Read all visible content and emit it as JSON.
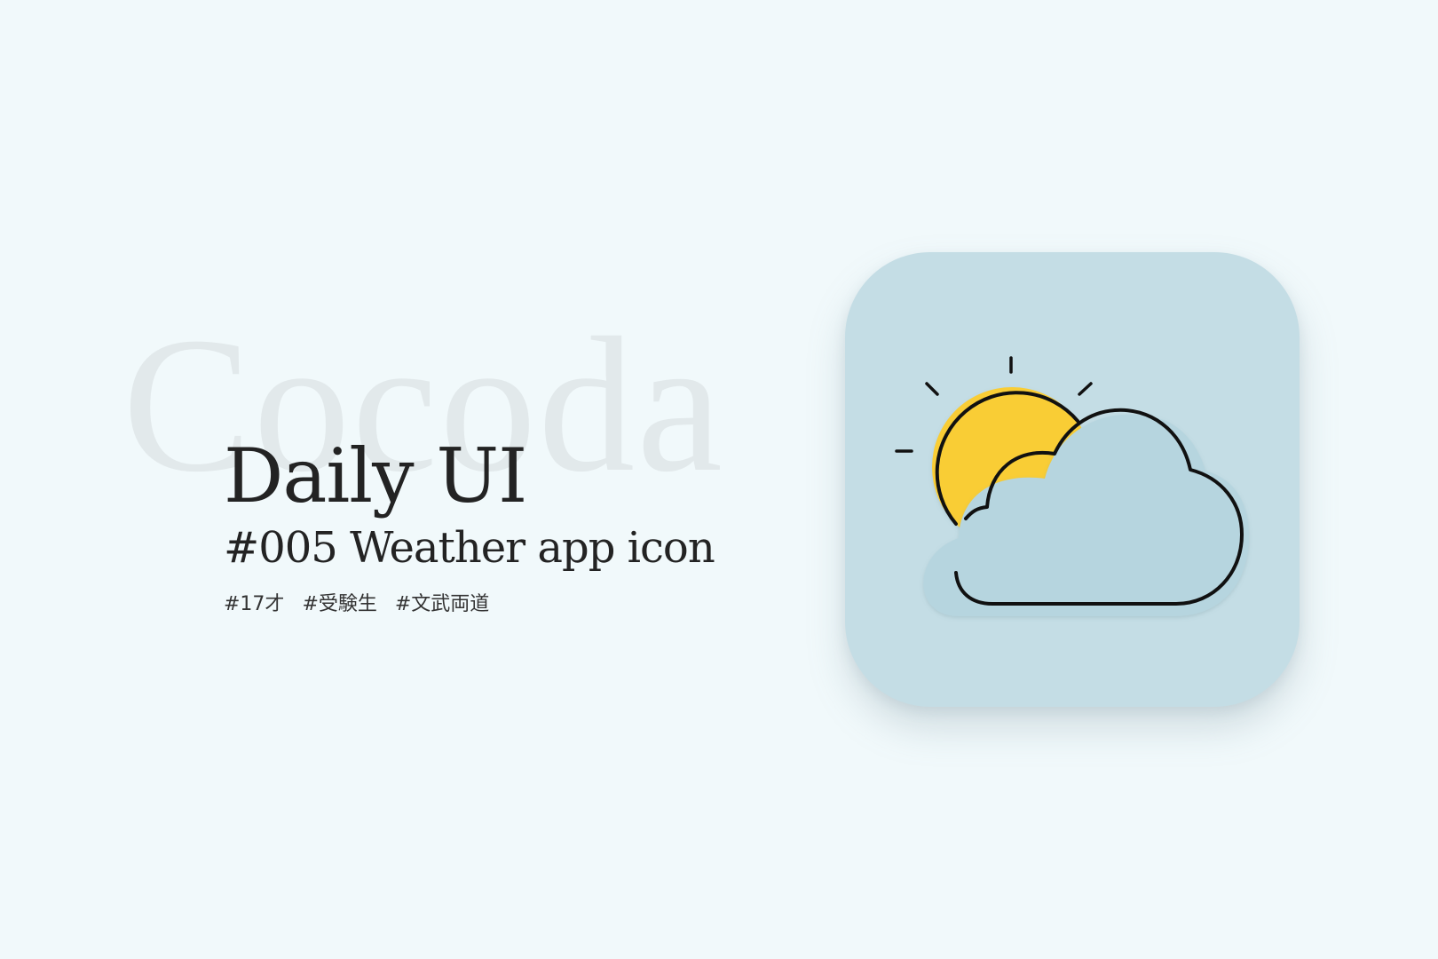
{
  "watermark": "Cocoda",
  "title": "Daily UI",
  "subtitle": "#005 Weather app icon",
  "tags": [
    "#17才",
    "#受験生",
    "#文武両道"
  ],
  "icon": {
    "name": "weather-partly-cloudy-icon",
    "colors": {
      "background": "#c4dde5",
      "sun": "#f9cd34",
      "cloud": "#b6d5df",
      "stroke": "#111111"
    }
  }
}
